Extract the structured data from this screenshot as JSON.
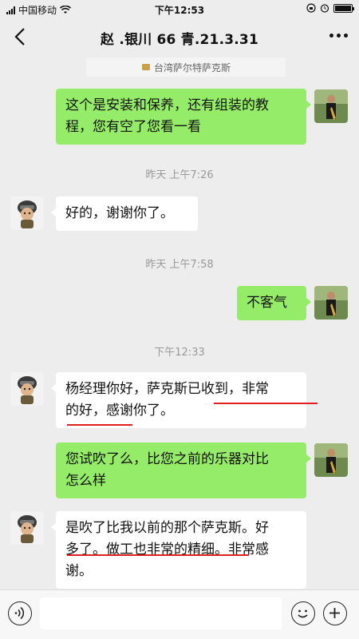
{
  "status_bar": {
    "carrier": "中国移动",
    "time": "下午12:53",
    "battery_level": 1.0
  },
  "nav": {
    "title": "赵     .银川 66 青.21.3.31"
  },
  "quote": {
    "text": "台湾萨尔特萨克斯"
  },
  "messages": [
    {
      "side": "right",
      "text_lines": [
        "这个是安装和保养，还有组装的教",
        "程，您有空了您看一看"
      ]
    },
    {
      "type": "time",
      "text": "昨天 上午7:26"
    },
    {
      "side": "left",
      "text_lines": [
        "好的，谢谢你了。"
      ]
    },
    {
      "type": "time",
      "text": "昨天 上午7:58"
    },
    {
      "side": "right",
      "text_lines": [
        "不客气"
      ]
    },
    {
      "type": "time",
      "text": "下午12:33"
    },
    {
      "side": "left",
      "text_lines": [
        "杨经理你好，萨克斯已收到，非常",
        "的好，感谢你了。"
      ]
    },
    {
      "side": "right",
      "text_lines": [
        "您试吹了么，比您之前的乐器对比",
        "怎么样"
      ]
    },
    {
      "side": "left",
      "text_lines": [
        "是吹了比我以前的那个萨克斯。好",
        "多了。做工也非常的精细。非常感",
        "谢。"
      ]
    }
  ],
  "colors": {
    "background": "#ededed",
    "sent_bubble": "#95ec69",
    "received_bubble": "#ffffff",
    "underline": "#e02020"
  },
  "icons": {
    "back": "chevron-left-icon",
    "more": "more-dots-icon",
    "voice": "voice-icon",
    "emoji": "emoji-icon",
    "plus": "plus-icon"
  }
}
